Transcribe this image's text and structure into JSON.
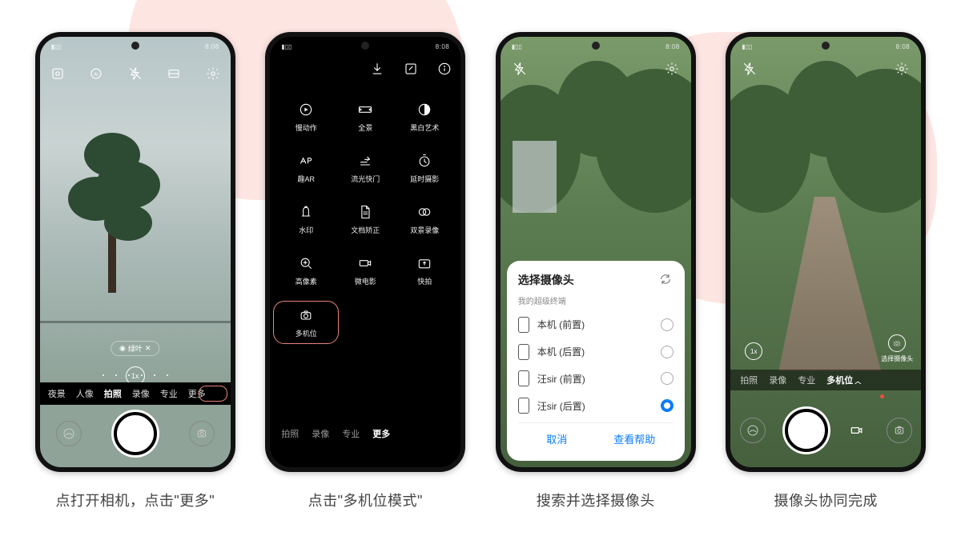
{
  "status": {
    "time": "8:08",
    "signal": "5G"
  },
  "phone1": {
    "filter_pill": "绿叶",
    "zoom": "1x",
    "modes": [
      "夜景",
      "人像",
      "拍照",
      "录像",
      "专业",
      "更多"
    ],
    "active_mode_index": 2
  },
  "phone2": {
    "grid": [
      {
        "icon": "slowmo",
        "label": "慢动作"
      },
      {
        "icon": "pano",
        "label": "全景"
      },
      {
        "icon": "bw",
        "label": "黑白艺术"
      },
      {
        "icon": "ar",
        "label": "趣AR"
      },
      {
        "icon": "light",
        "label": "流光快门"
      },
      {
        "icon": "timelapse",
        "label": "延时摄影"
      },
      {
        "icon": "watermark",
        "label": "水印"
      },
      {
        "icon": "doc",
        "label": "文档矫正"
      },
      {
        "icon": "dualview",
        "label": "双景录像"
      },
      {
        "icon": "hires",
        "label": "高像素"
      },
      {
        "icon": "microfilm",
        "label": "微电影"
      },
      {
        "icon": "snapshot",
        "label": "快拍"
      },
      {
        "icon": "multicam",
        "label": "多机位"
      }
    ],
    "highlight_index": 12,
    "modes": [
      "拍照",
      "录像",
      "专业",
      "更多"
    ],
    "active_mode_index": 3
  },
  "phone3": {
    "sheet_title": "选择摄像头",
    "sheet_sub": "我的超级终端",
    "devices": [
      {
        "label": "本机 (前置)",
        "selected": false
      },
      {
        "label": "本机 (后置)",
        "selected": false
      },
      {
        "label": "汪sir (前置)",
        "selected": false
      },
      {
        "label": "汪sir (后置)",
        "selected": true
      }
    ],
    "cancel": "取消",
    "help": "查看帮助"
  },
  "phone4": {
    "zoom": "1x",
    "select_cam_label": "选择摄像头",
    "modes": [
      "拍照",
      "录像",
      "专业",
      "多机位"
    ],
    "active_mode_index": 3
  },
  "captions": [
    "点打开相机，点击\"更多\"",
    "点击\"多机位模式\"",
    "搜索并选择摄像头",
    "摄像头协同完成"
  ]
}
